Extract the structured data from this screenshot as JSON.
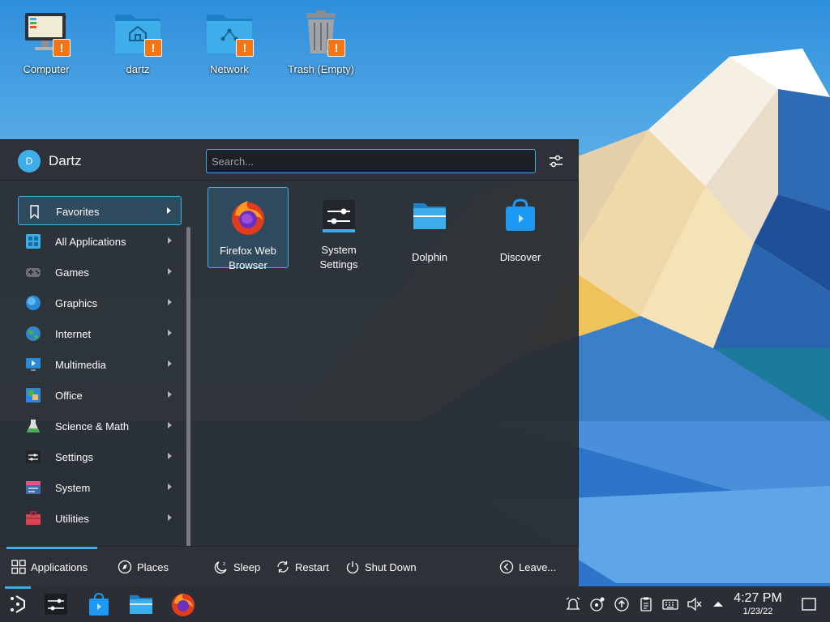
{
  "desktop": {
    "icons": [
      {
        "label": "Computer",
        "icon": "computer-icon"
      },
      {
        "label": "dartz",
        "icon": "home-folder-icon"
      },
      {
        "label": "Network",
        "icon": "network-folder-icon"
      },
      {
        "label": "Trash (Empty)",
        "icon": "trash-icon"
      }
    ],
    "warning_badge": "!"
  },
  "launcher": {
    "user": {
      "name": "Dartz",
      "avatar_letter": "D"
    },
    "search": {
      "placeholder": "Search...",
      "value": ""
    },
    "categories": [
      {
        "label": "Favorites",
        "icon": "bookmark-icon",
        "active": true
      },
      {
        "label": "All Applications",
        "icon": "grid-icon"
      },
      {
        "label": "Games",
        "icon": "gamepad-icon"
      },
      {
        "label": "Graphics",
        "icon": "graphics-icon"
      },
      {
        "label": "Internet",
        "icon": "globe-icon"
      },
      {
        "label": "Multimedia",
        "icon": "multimedia-icon"
      },
      {
        "label": "Office",
        "icon": "office-icon"
      },
      {
        "label": "Science & Math",
        "icon": "flask-icon"
      },
      {
        "label": "Settings",
        "icon": "settings-icon"
      },
      {
        "label": "System",
        "icon": "system-icon"
      },
      {
        "label": "Utilities",
        "icon": "toolbox-icon"
      }
    ],
    "favorites": [
      {
        "label_line1": "Firefox Web",
        "label_line2": "Browser",
        "icon": "firefox-icon"
      },
      {
        "label_line1": "System",
        "label_line2": "Settings",
        "icon": "system-settings-icon"
      },
      {
        "label_line1": "Dolphin",
        "label_line2": "",
        "icon": "dolphin-icon"
      },
      {
        "label_line1": "Discover",
        "label_line2": "",
        "icon": "discover-icon"
      }
    ],
    "footer": {
      "applications": "Applications",
      "places": "Places",
      "sleep": "Sleep",
      "restart": "Restart",
      "shutdown": "Shut Down",
      "leave": "Leave..."
    }
  },
  "taskbar": {
    "tasks": [
      "application-launcher-icon",
      "system-settings-icon",
      "discover-icon",
      "dolphin-icon",
      "firefox-icon"
    ],
    "clock": {
      "time": "4:27 PM",
      "date": "1/23/22"
    }
  },
  "colors": {
    "accent": "#3daee9",
    "panel": "#2a2e34",
    "warning": "#f47514"
  }
}
